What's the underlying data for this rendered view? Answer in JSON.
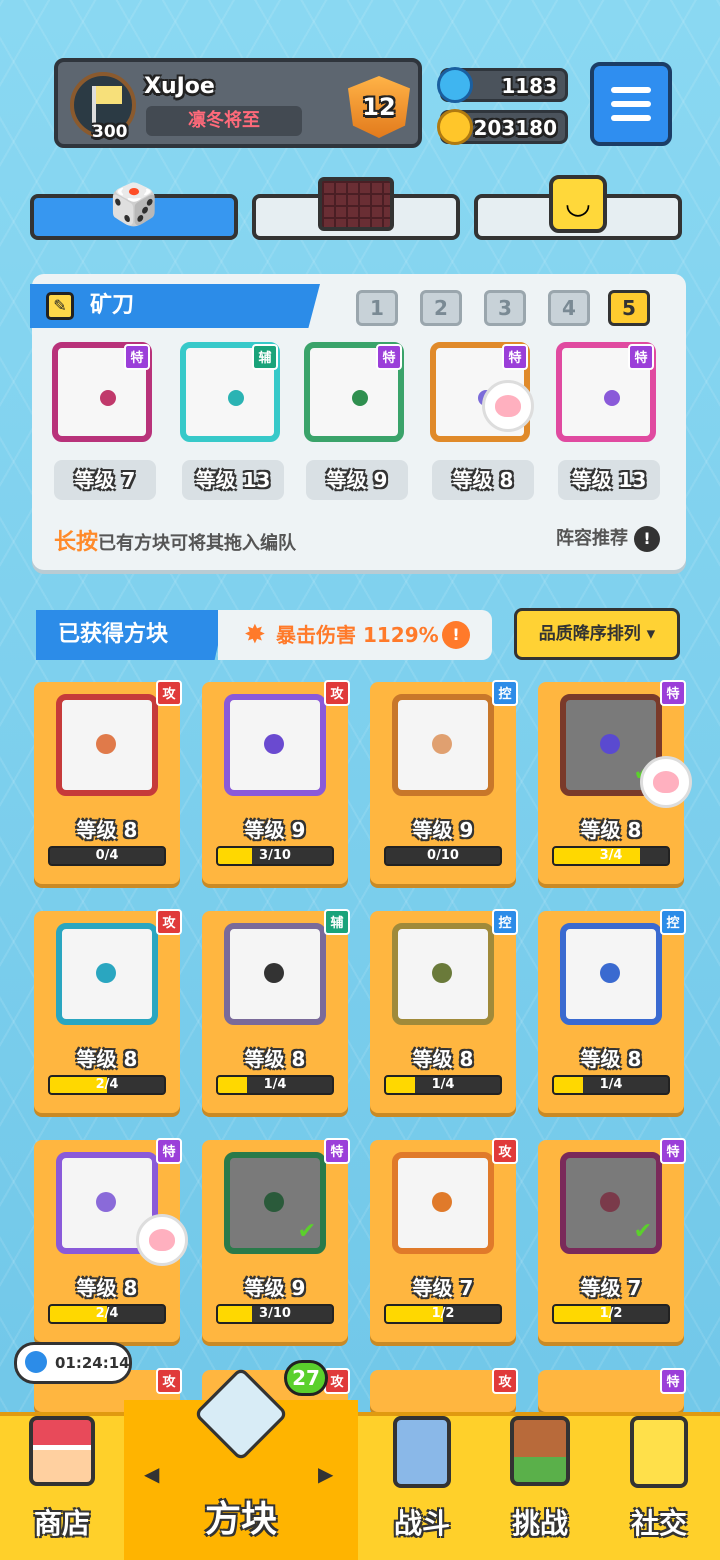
{
  "profile": {
    "name": "XuJoe",
    "title": "凛冬将至",
    "level": "300",
    "rank": "12"
  },
  "currency": {
    "gems": "1183",
    "coins": "203180"
  },
  "deck": {
    "title": "矿刀",
    "pages": [
      "1",
      "2",
      "3",
      "4",
      "5"
    ],
    "active_page": "5",
    "slots": [
      {
        "level": "等级 7",
        "tag": "特",
        "tag_color": "#9b3fd9",
        "frame": "#b8327a",
        "dot": "#c0396b"
      },
      {
        "level": "等级 13",
        "tag": "辅",
        "tag_color": "#1aa37a",
        "frame": "#37c9c9",
        "dot": "#2bb3b3"
      },
      {
        "level": "等级 9",
        "tag": "特",
        "tag_color": "#9b3fd9",
        "frame": "#3aa36a",
        "dot": "#2f8f4f"
      },
      {
        "level": "等级 8",
        "tag": "特",
        "tag_color": "#9b3fd9",
        "frame": "#e08a2a",
        "dot": "#7b6bd9"
      },
      {
        "level": "等级 13",
        "tag": "特",
        "tag_color": "#9b3fd9",
        "frame": "#e04aa0",
        "dot": "#8a5ad9"
      }
    ],
    "hint_bold": "长按",
    "hint_rest": "已有方块可将其拖入编队",
    "recommend": "阵容推荐"
  },
  "owned": {
    "title": "已获得方块",
    "crit": "暴击伤害 1129%",
    "sort": "品质降序排列 ▾",
    "cards": [
      {
        "level": "等级 8",
        "progress": "0/4",
        "fill": 0,
        "tag": "攻",
        "tag_color": "#e03a3a",
        "frame": "#c63a3a",
        "dot": "#e07a4a",
        "check": false,
        "bg": "#f5f5f5"
      },
      {
        "level": "等级 9",
        "progress": "3/10",
        "fill": 0.3,
        "tag": "攻",
        "tag_color": "#e03a3a",
        "frame": "#8a5ad9",
        "dot": "#6a4ad0",
        "check": false,
        "bg": "#f5f5f5"
      },
      {
        "level": "等级 9",
        "progress": "0/10",
        "fill": 0,
        "tag": "控",
        "tag_color": "#2c8ce8",
        "frame": "#c8772a",
        "dot": "#e0a070",
        "check": false,
        "bg": "#f5f5f5"
      },
      {
        "level": "等级 8",
        "progress": "3/4",
        "fill": 0.75,
        "tag": "特",
        "tag_color": "#9b3fd9",
        "frame": "#7a3a2a",
        "dot": "#5a4ad0",
        "check": true,
        "bg": "#7a7a7a"
      },
      {
        "level": "等级 8",
        "progress": "2/4",
        "fill": 0.5,
        "tag": "攻",
        "tag_color": "#e03a3a",
        "frame": "#2aa6c0",
        "dot": "#2aa6c0",
        "check": false,
        "bg": "#f5f5f5"
      },
      {
        "level": "等级 8",
        "progress": "1/4",
        "fill": 0.25,
        "tag": "辅",
        "tag_color": "#1aa37a",
        "frame": "#7a6a9a",
        "dot": "#333333",
        "check": false,
        "bg": "#f5f5f5"
      },
      {
        "level": "等级 8",
        "progress": "1/4",
        "fill": 0.25,
        "tag": "控",
        "tag_color": "#2c8ce8",
        "frame": "#a08a3a",
        "dot": "#6a7a3a",
        "check": false,
        "bg": "#f5f5f5"
      },
      {
        "level": "等级 8",
        "progress": "1/4",
        "fill": 0.25,
        "tag": "控",
        "tag_color": "#2c8ce8",
        "frame": "#3a6ad0",
        "dot": "#3a6ad0",
        "check": false,
        "bg": "#f5f5f5"
      },
      {
        "level": "等级 8",
        "progress": "2/4",
        "fill": 0.5,
        "tag": "特",
        "tag_color": "#9b3fd9",
        "frame": "#8a5ad9",
        "dot": "#8a6ad9",
        "check": false,
        "bg": "#f5f5f5"
      },
      {
        "level": "等级 9",
        "progress": "3/10",
        "fill": 0.3,
        "tag": "特",
        "tag_color": "#9b3fd9",
        "frame": "#2a7a4a",
        "dot": "#2a5a3a",
        "check": true,
        "bg": "#7a7a7a"
      },
      {
        "level": "等级 7",
        "progress": "1/2",
        "fill": 0.5,
        "tag": "攻",
        "tag_color": "#e03a3a",
        "frame": "#e07a2a",
        "dot": "#e07a2a",
        "check": false,
        "bg": "#f5f5f5"
      },
      {
        "level": "等级 7",
        "progress": "1/2",
        "fill": 0.5,
        "tag": "特",
        "tag_color": "#9b3fd9",
        "frame": "#7a2a5a",
        "dot": "#7a3a4a",
        "check": true,
        "bg": "#7a7a7a"
      }
    ],
    "partial_tags": [
      {
        "tag": "攻",
        "tag_color": "#e03a3a"
      },
      {
        "tag": "攻",
        "tag_color": "#e03a3a"
      },
      {
        "tag": "攻",
        "tag_color": "#e03a3a"
      },
      {
        "tag": "特",
        "tag_color": "#9b3fd9"
      }
    ]
  },
  "timer": "01:24:14",
  "nav": {
    "shop": "商店",
    "blocks": "方块",
    "battle": "战斗",
    "challenge": "挑战",
    "social": "社交",
    "badge": "27"
  }
}
